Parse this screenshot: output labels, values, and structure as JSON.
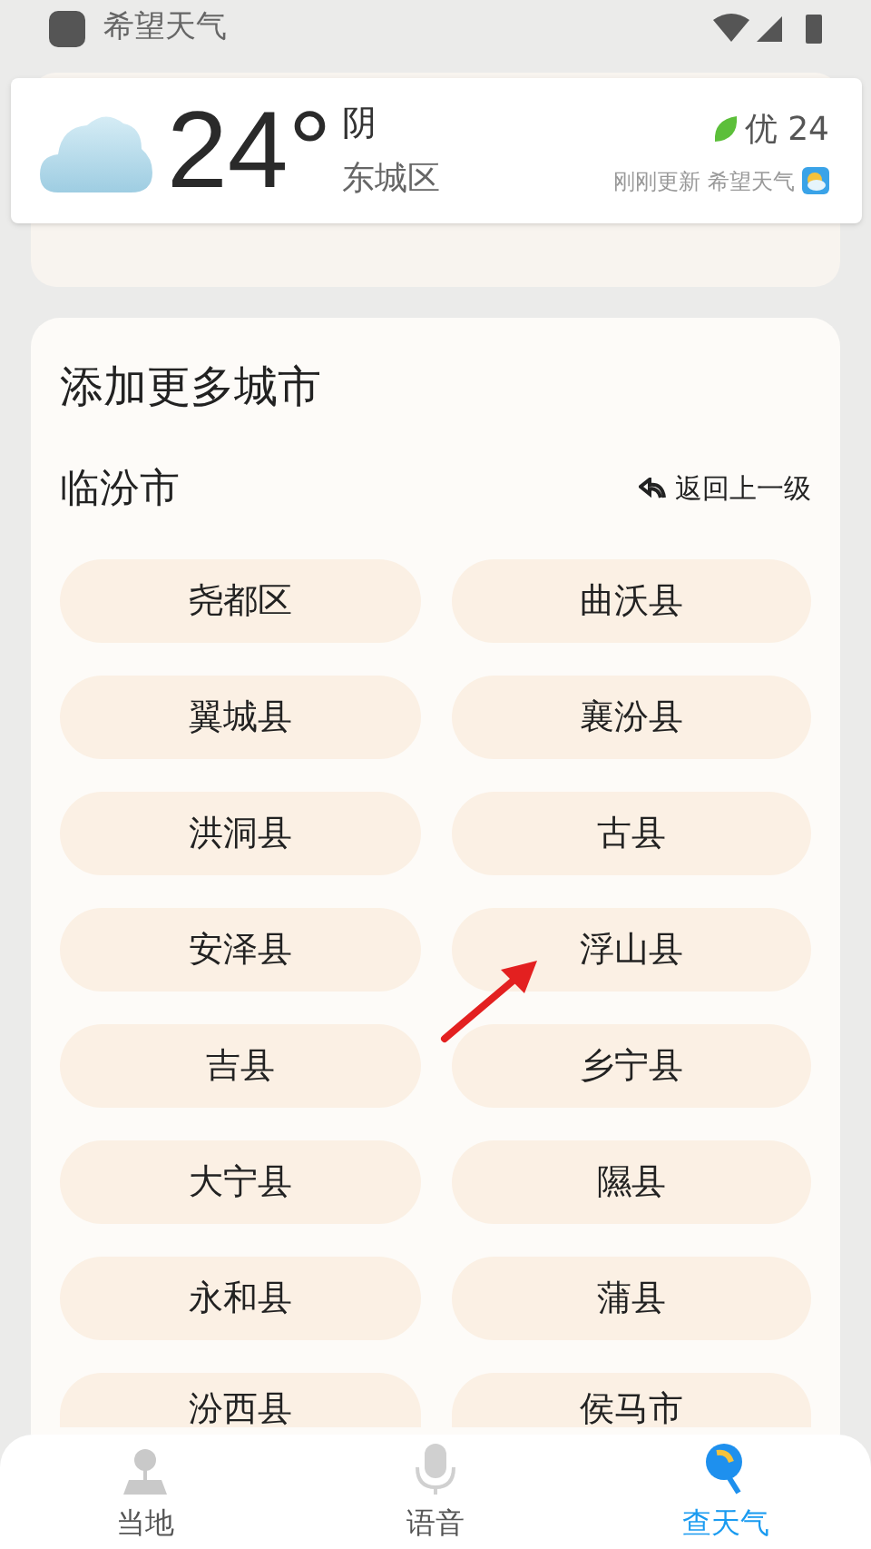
{
  "status_bar": {
    "app_name": "希望天气"
  },
  "notification": {
    "temperature": "24°",
    "condition": "阴",
    "district": "东城区",
    "aqi": "优 24",
    "update": "刚刚更新 希望天气"
  },
  "panel": {
    "title": "添加更多城市",
    "city": "临汾市",
    "back": "返回上一级",
    "districts": [
      {
        "label": "尧都区"
      },
      {
        "label": "曲沃县"
      },
      {
        "label": "翼城县"
      },
      {
        "label": "襄汾县"
      },
      {
        "label": "洪洞县"
      },
      {
        "label": "古县"
      },
      {
        "label": "安泽县"
      },
      {
        "label": "浮山县"
      },
      {
        "label": "吉县"
      },
      {
        "label": "乡宁县"
      },
      {
        "label": "大宁县"
      },
      {
        "label": "隰县"
      },
      {
        "label": "永和县"
      },
      {
        "label": "蒲县"
      },
      {
        "label": "汾西县"
      },
      {
        "label": "侯马市"
      }
    ]
  },
  "nav": [
    {
      "label": "当地",
      "kind": "local",
      "selected": false
    },
    {
      "label": "语音",
      "kind": "voice",
      "selected": false
    },
    {
      "label": "查天气",
      "kind": "search",
      "selected": true
    }
  ]
}
